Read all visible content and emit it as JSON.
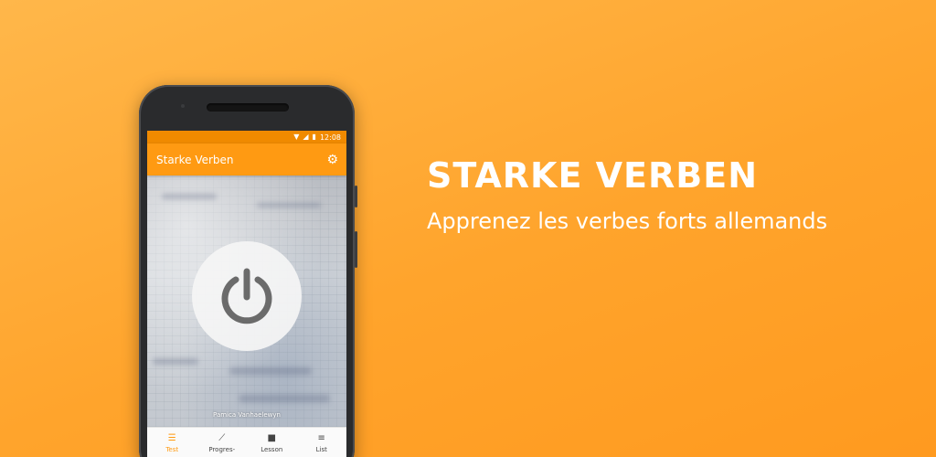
{
  "banner": {
    "title": "STARKE VERBEN",
    "subtitle": "Apprenez les verbes forts allemands"
  },
  "phone": {
    "status_bar": {
      "time": "12:08",
      "icons": [
        "wifi-icon",
        "signal-icon",
        "battery-icon"
      ]
    },
    "app_bar": {
      "title": "Starke Verben",
      "action_icon": "gear-icon"
    },
    "main": {
      "start_icon": "power-icon",
      "photo_credit": "Pamica Vanhaelewyn"
    },
    "bottom_nav": [
      {
        "label": "Test",
        "icon": "test-icon",
        "active": true
      },
      {
        "label": "Progres-",
        "icon": "chart-icon",
        "active": false
      },
      {
        "label": "Lesson",
        "icon": "book-icon",
        "active": false
      },
      {
        "label": "List",
        "icon": "list-icon",
        "active": false
      }
    ]
  },
  "colors": {
    "background": "#ffa42c",
    "app_bar": "#ff9a12",
    "status_bar": "#f08a00",
    "active_nav": "#ff9a12"
  }
}
